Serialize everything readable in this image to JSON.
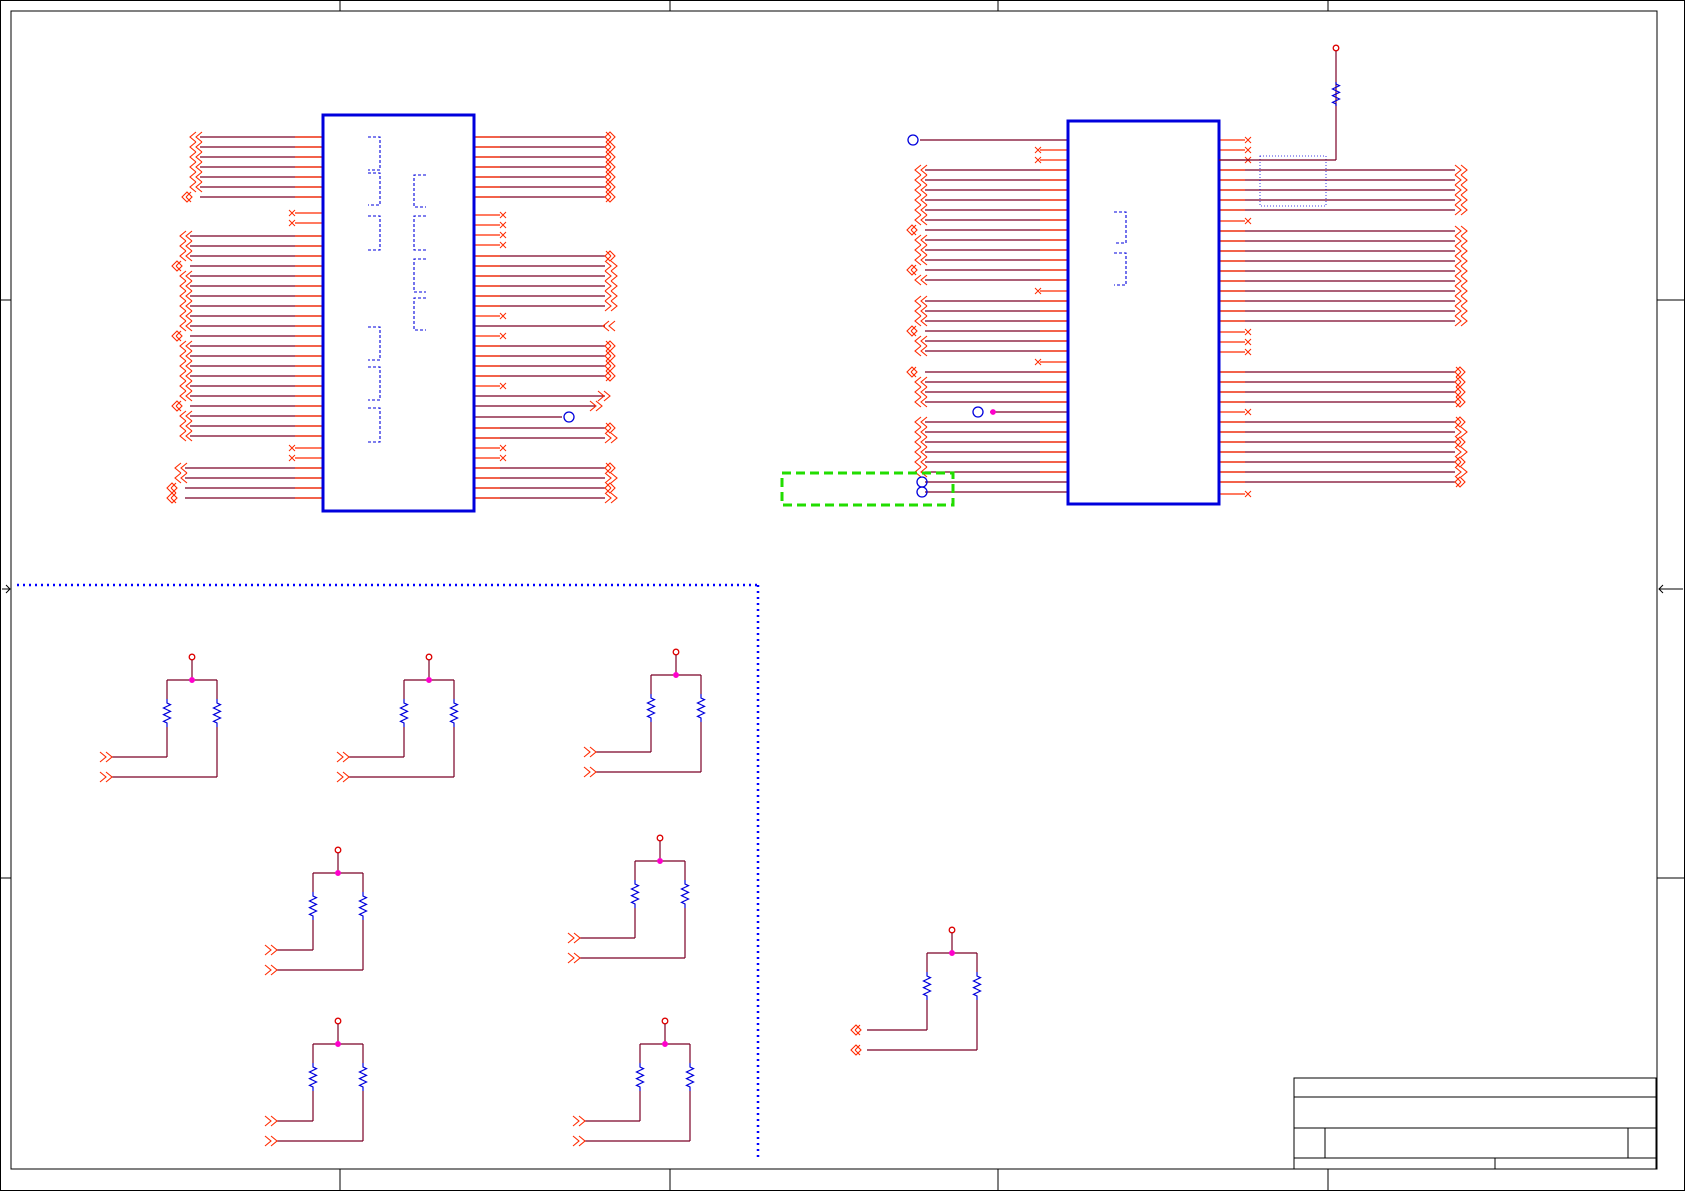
{
  "colors": {
    "frame": "#000000",
    "wire": "#7a0026",
    "pin": "#ff2a00",
    "ic_border": "#0000dd",
    "resistor": "#0000dd",
    "junction": "#ff00cc",
    "power_pin": "#dd0000",
    "group_outline": "#0000ff",
    "selection": "#22dd00",
    "background": "#ffffff"
  },
  "title_block": {
    "title": "",
    "size": "",
    "document_number": "",
    "revision": "",
    "date": "",
    "sheet": ""
  }
}
